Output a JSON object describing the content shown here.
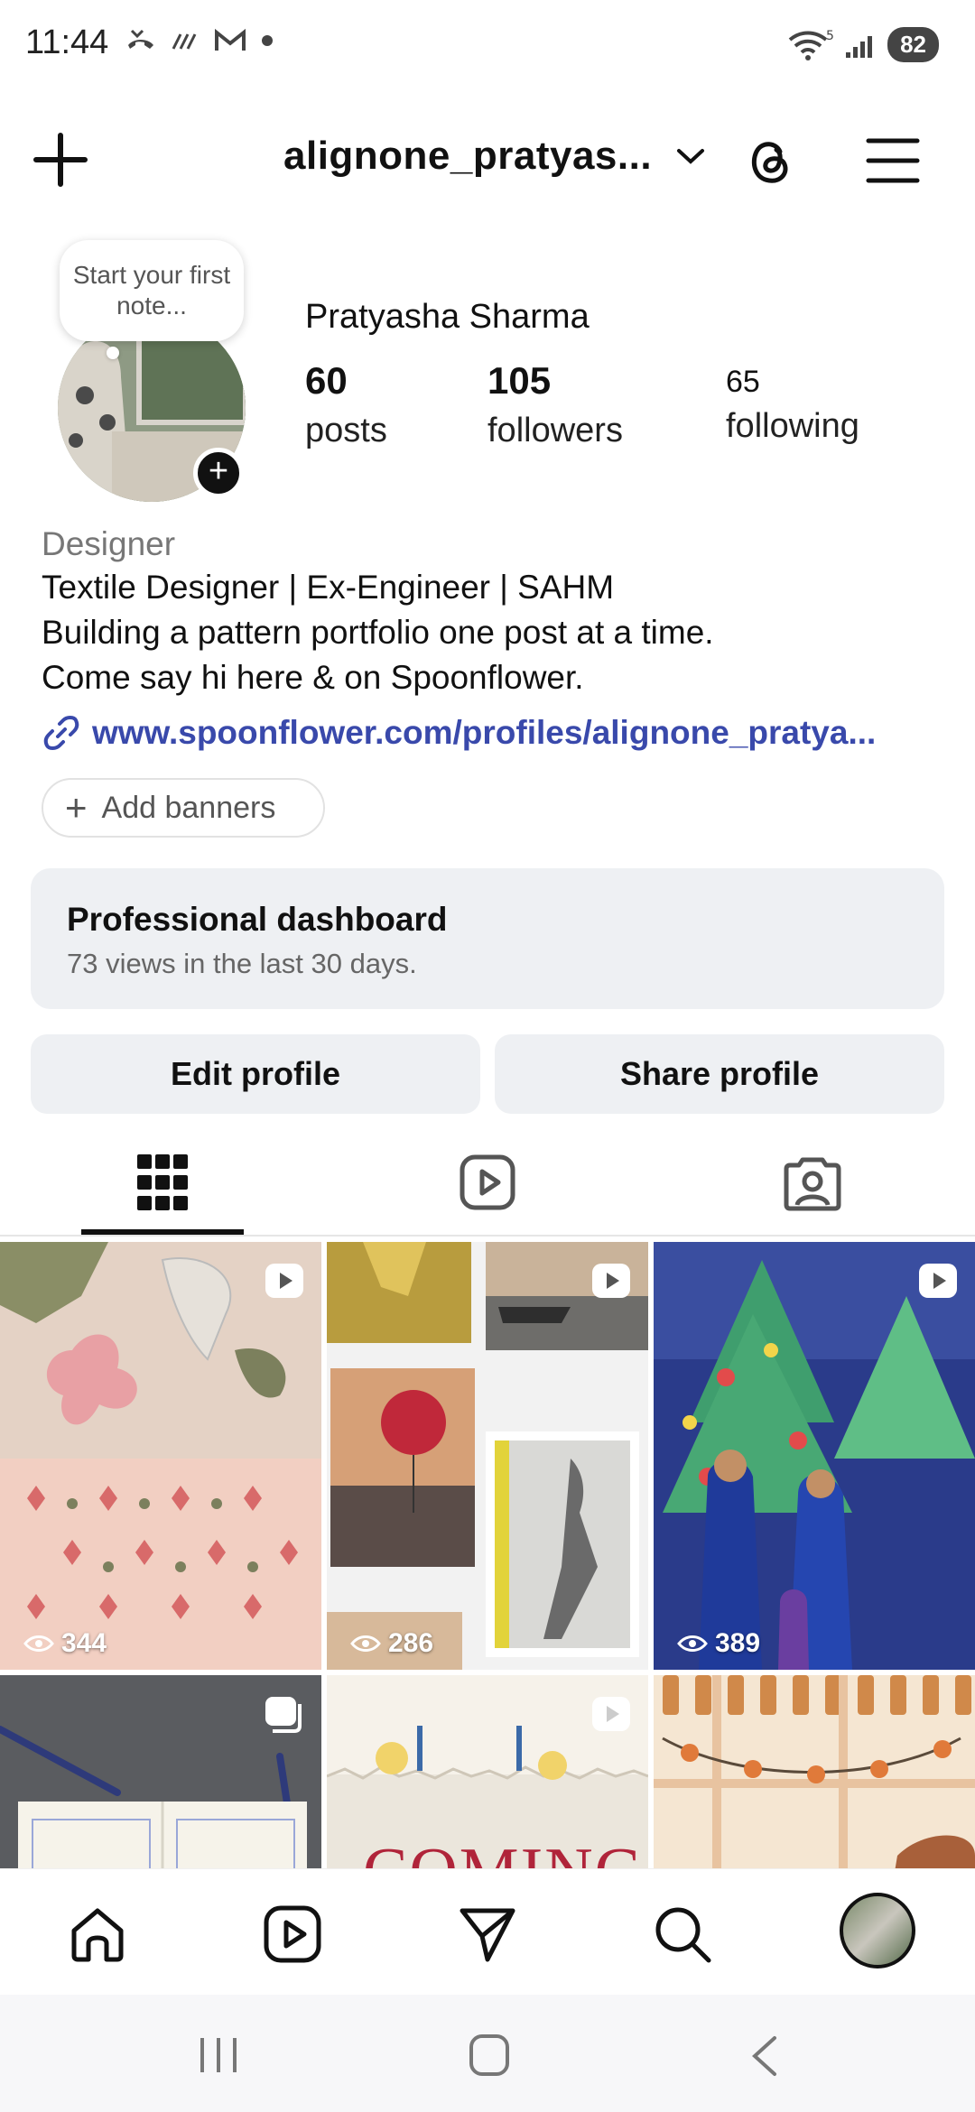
{
  "status_bar": {
    "time": "11:44",
    "battery": "82",
    "signal_label": "5"
  },
  "header": {
    "username": "alignone_pratyas..."
  },
  "profile": {
    "note": "Start your first note...",
    "full_name": "Pratyasha Sharma",
    "stats": [
      {
        "value": "60",
        "label": "posts"
      },
      {
        "value": "105",
        "label": "followers"
      },
      {
        "value": "65",
        "label": "following"
      }
    ],
    "category": "Designer",
    "bio_lines": [
      "Textile Designer | Ex-Engineer | SAHM",
      "Building a pattern portfolio one post at a time.",
      "Come say hi here & on Spoonflower."
    ],
    "link": "www.spoonflower.com/profiles/alignone_pratya...",
    "add_banners": "Add banners"
  },
  "dashboard": {
    "title": "Professional dashboard",
    "subtitle": "73 views in the last 30 days."
  },
  "actions": {
    "edit": "Edit profile",
    "share": "Share profile"
  },
  "tabs": [
    "grid-icon",
    "reels-icon",
    "tagged-icon"
  ],
  "grid": {
    "posts": [
      {
        "views": "344",
        "type": "reel"
      },
      {
        "views": "286",
        "type": "reel"
      },
      {
        "views": "389",
        "type": "reel"
      },
      {
        "views": "",
        "type": "carousel"
      },
      {
        "views": "",
        "type": "reel",
        "overlay_text": "COMING"
      },
      {
        "views": "",
        "type": "post"
      }
    ]
  },
  "bottom_nav": [
    "home-icon",
    "reels-icon",
    "send-icon",
    "search-icon",
    "profile-avatar"
  ],
  "colors": {
    "link": "#3949ab",
    "card_bg": "#eef0f3",
    "text": "#111111"
  }
}
